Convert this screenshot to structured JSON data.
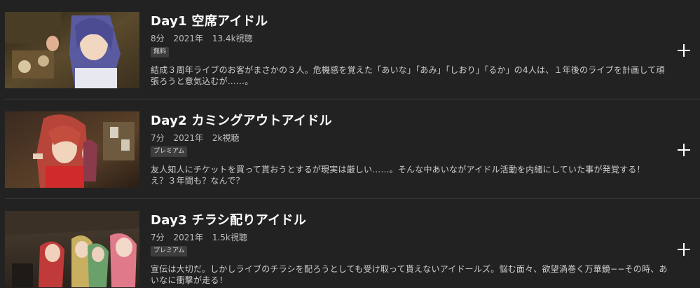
{
  "episodes": [
    {
      "title": "Day1 空席アイドル",
      "duration": "8分",
      "year": "2021年",
      "views": "13.4k視聴",
      "badge": "無料",
      "description": "結成３周年ライブのお客がまさかの３人。危機感を覚えた「あいな」「あみ」「しおり」「るか」の4人は、１年後のライブを計画して頑張ろうと意気込むが……。"
    },
    {
      "title": "Day2 カミングアウトアイドル",
      "duration": "7分",
      "year": "2021年",
      "views": "2k視聴",
      "badge": "プレミアム",
      "description": "友人知人にチケットを買って貰おうとするが現実は厳しい……。そんな中あいながアイドル活動を内緒にしていた事が発覚する！　え？３年間も？なんで？"
    },
    {
      "title": "Day3 チラシ配りアイドル",
      "duration": "7分",
      "year": "2021年",
      "views": "1.5k視聴",
      "badge": "プレミアム",
      "description": "宣伝は大切だ。しかしライブのチラシを配ろうとしても受け取って貰えないアイドールズ。悩む面々、欲望渦巻く万華鏡−−その時、あいなに衝撃が走る！"
    }
  ]
}
